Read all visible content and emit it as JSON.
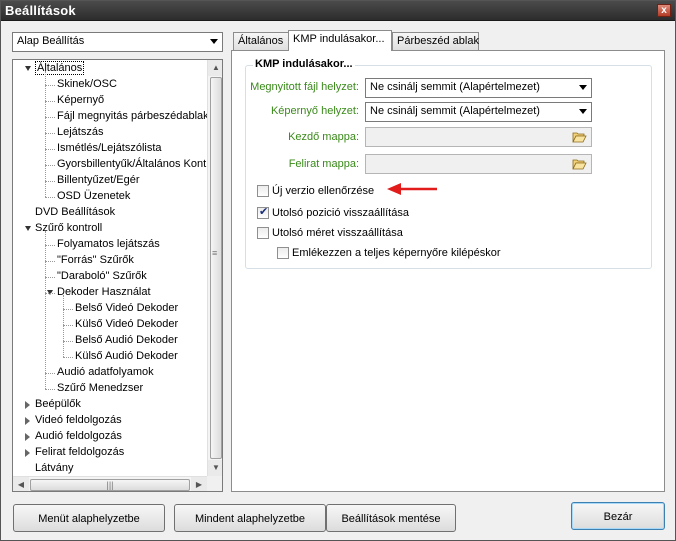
{
  "window": {
    "title": "Beállítások",
    "close_glyph": "x"
  },
  "preset_combo": {
    "value": "Alap Beállítás"
  },
  "tree": [
    {
      "label": "Általános",
      "level": 0,
      "expanded": true,
      "selected": true
    },
    {
      "label": "Skinek/OSC",
      "level": 1
    },
    {
      "label": "Képernyő",
      "level": 1
    },
    {
      "label": "Fájl megnyitás párbeszédablak",
      "level": 1
    },
    {
      "label": "Lejátszás",
      "level": 1
    },
    {
      "label": "Ismétlés/Lejátszólista",
      "level": 1
    },
    {
      "label": "Gyorsbillentyűk/Általános Kontr",
      "level": 1
    },
    {
      "label": "Billentyűzet/Egér",
      "level": 1
    },
    {
      "label": "OSD Üzenetek",
      "level": 1
    },
    {
      "label": "DVD Beállítások",
      "level": 0
    },
    {
      "label": "Szűrő kontroll",
      "level": 0,
      "expanded": true
    },
    {
      "label": "Folyamatos lejátszás",
      "level": 1
    },
    {
      "label": "\"Forrás\" Szűrők",
      "level": 1
    },
    {
      "label": "\"Daraboló\" Szűrők",
      "level": 1
    },
    {
      "label": "Dekoder Használat",
      "level": 1,
      "expanded": true
    },
    {
      "label": "Belső Videó Dekoder",
      "level": 2
    },
    {
      "label": "Külső Videó Dekoder",
      "level": 2
    },
    {
      "label": "Belső Audió Dekoder",
      "level": 2
    },
    {
      "label": "Külső Audió Dekoder",
      "level": 2
    },
    {
      "label": "Audió adatfolyamok",
      "level": 1
    },
    {
      "label": "Szűrő Menedzser",
      "level": 1
    },
    {
      "label": "Beépülők",
      "level": 0,
      "collapsed": true
    },
    {
      "label": "Videó feldolgozás",
      "level": 0,
      "collapsed": true
    },
    {
      "label": "Audió feldolgozás",
      "level": 0,
      "collapsed": true
    },
    {
      "label": "Felirat feldolgozás",
      "level": 0,
      "collapsed": true
    },
    {
      "label": "Látvány",
      "level": 0
    }
  ],
  "tabs": [
    {
      "label": "Általános",
      "active": false
    },
    {
      "label": "KMP indulásakor...",
      "active": true
    },
    {
      "label": "Párbeszéd ablak",
      "active": false
    }
  ],
  "group": {
    "title": "KMP indulásakor...",
    "opened_file_label": "Megnyitott fájl helyzet:",
    "opened_file_value": "Ne csinálj semmit (Alapértelmezet)",
    "screen_label": "Képernyő helyzet:",
    "screen_value": "Ne csinálj semmit (Alapértelmezet)",
    "start_folder_label": "Kezdő mappa:",
    "start_folder_value": "",
    "subtitle_folder_label": "Felirat mappa:",
    "subtitle_folder_value": "",
    "checkboxes": [
      {
        "label": "Új verzio ellenőrzése",
        "checked": false
      },
      {
        "label": "Utolsó pozició visszaállítása",
        "checked": true
      },
      {
        "label": "Utolsó méret visszaállítása",
        "checked": false
      },
      {
        "label": "Emlékezzen a teljes képernyőre kilépéskor",
        "checked": false
      }
    ]
  },
  "buttons": {
    "reset_menu": "Menüt alaphelyzetbe",
    "reset_all": "Mindent alaphelyzetbe",
    "save": "Beállítások mentése",
    "close": "Bezár"
  },
  "colors": {
    "green_label": "#3a8a1a",
    "annotation_arrow": "#e21b1b"
  }
}
